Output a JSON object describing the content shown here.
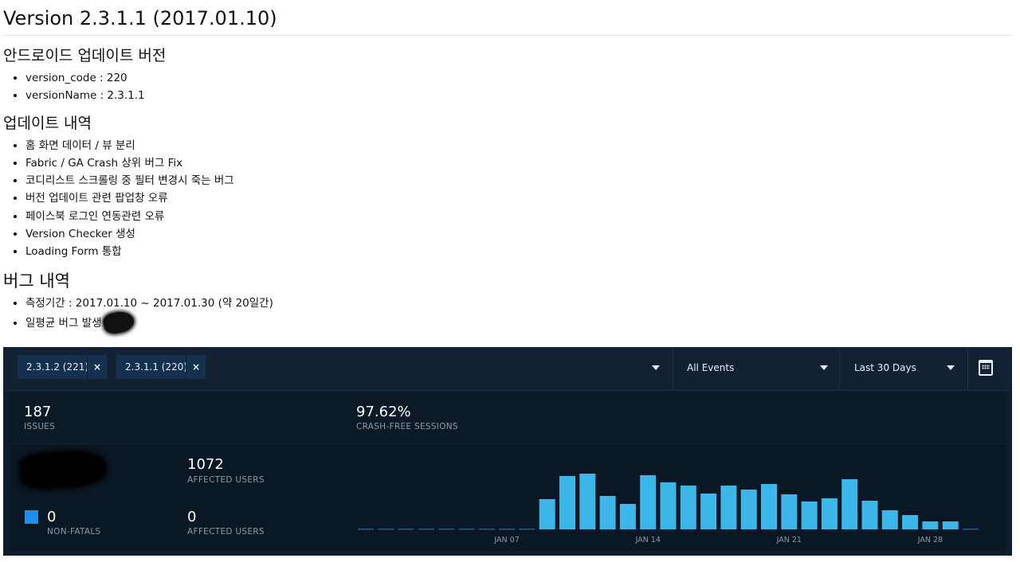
{
  "doc": {
    "title": "Version 2.3.1.1 (2017.01.10)",
    "section1": {
      "heading": "안드로이드 업데이트 버전",
      "items": [
        "version_code : 220",
        "versionName : 2.3.1.1"
      ]
    },
    "section2": {
      "heading": "업데이트 내역",
      "items": [
        "홈 화면 데이터 / 뷰 분리",
        "Fabric / GA Crash 상위 버그 Fix",
        "코디리스트 스크롤링 중 필터 변경시 죽는 버그",
        "버전 업데이트 관련 팝업창 오류",
        "페이스북 로그인 연동관련 오류",
        "Version Checker 생성",
        "Loading Form 통합"
      ]
    },
    "section3": {
      "heading": "버그 내역",
      "items": [
        "측정기간 : 2017.01.10 ~ 2017.01.30 (약 20일간)",
        "일평균 버그 발생 :"
      ]
    }
  },
  "dashboard": {
    "filters": {
      "chips": [
        {
          "label": "2.3.1.2 (221)",
          "remove": "×"
        },
        {
          "label": "2.3.1.1 (220)",
          "remove": "×"
        }
      ],
      "events_select": "All Events",
      "range_select": "Last 30 Days",
      "calendar_icon": "calendar-icon"
    },
    "stats": {
      "issues_value": "187",
      "issues_label": "ISSUES",
      "crash_free_value": "97.62%",
      "crash_free_label": "CRASH-FREE SESSIONS",
      "affected_users_1_value": "1072",
      "affected_users_1_label": "AFFECTED USERS",
      "nonfatals_value": "0",
      "nonfatals_label": "NON-FATALS",
      "affected_users_2_value": "0",
      "affected_users_2_label": "AFFECTED USERS"
    },
    "colors": {
      "bar": "#3db6ea",
      "nonfatal": "#1e8ff0",
      "baseline": "#2b5a8a"
    }
  },
  "chart_data": {
    "type": "bar",
    "x_tick_labels": [
      "JAN 07",
      "JAN 14",
      "JAN 21",
      "JAN 28"
    ],
    "values": [
      0,
      0,
      0,
      0,
      0,
      0,
      0,
      0,
      0,
      38,
      67,
      70,
      42,
      32,
      68,
      59,
      55,
      45,
      55,
      50,
      57,
      44,
      35,
      39,
      63,
      36,
      24,
      18,
      10,
      10,
      0
    ],
    "ylim": [
      0,
      75
    ],
    "tick_indices": [
      7,
      14,
      21,
      28
    ]
  }
}
